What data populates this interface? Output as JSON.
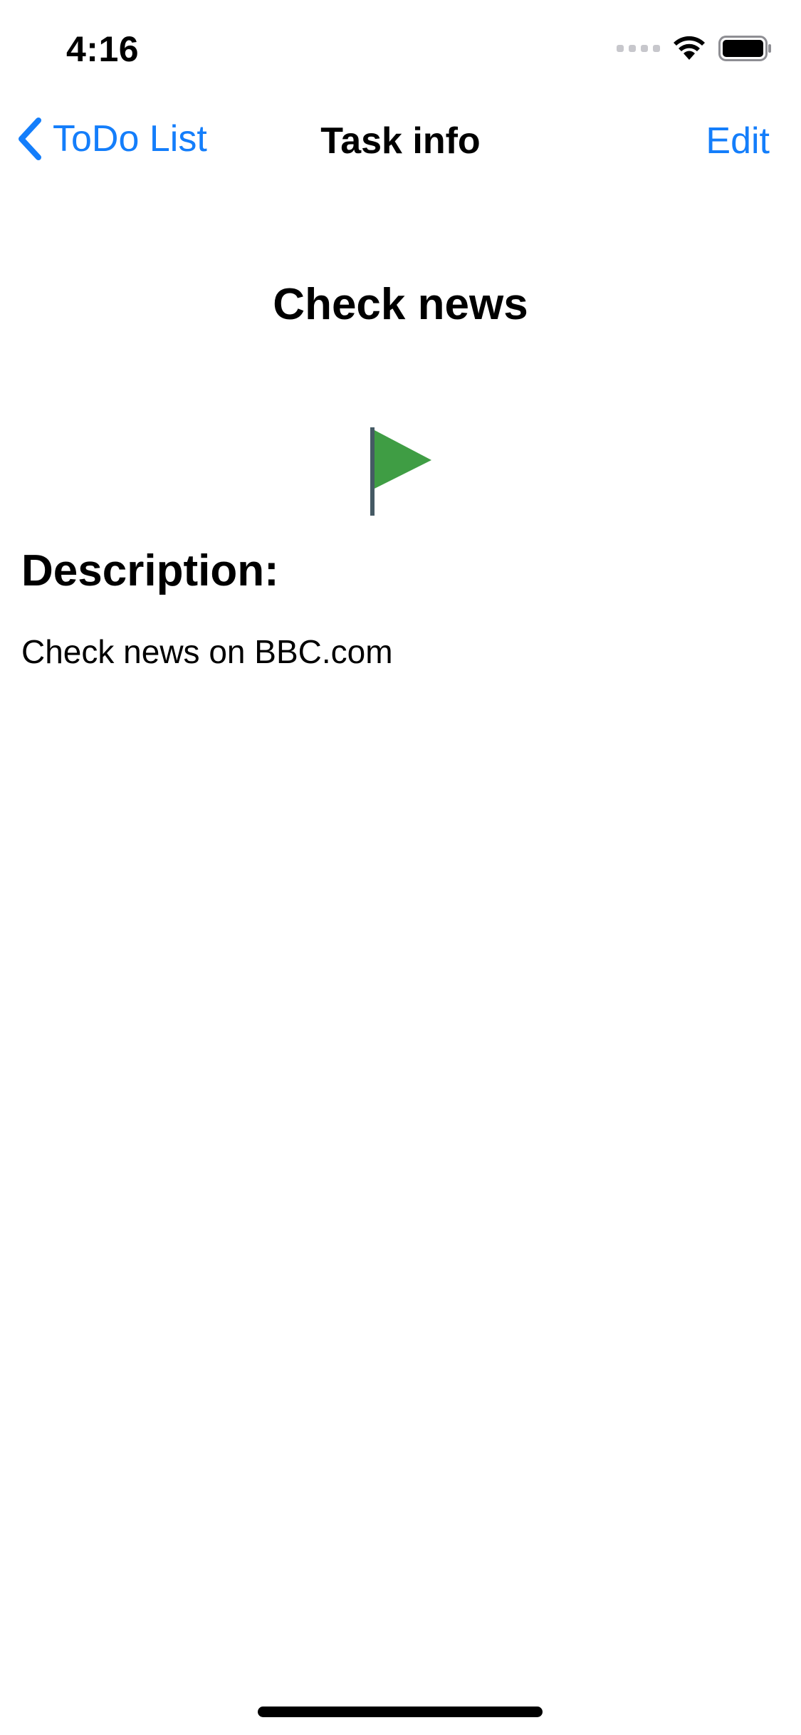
{
  "status_bar": {
    "time": "4:16",
    "icons": [
      "cellular-signal-icon",
      "wifi-icon",
      "battery-icon"
    ]
  },
  "nav": {
    "back_label": "ToDo List",
    "title": "Task info",
    "edit_label": "Edit"
  },
  "task": {
    "title": "Check news",
    "flag_icon": "green-flag-icon",
    "flag_color": "#3f9d44",
    "description_heading": "Description:",
    "description": "Check news on BBC.com"
  },
  "colors": {
    "accent": "#147efb",
    "text": "#000000",
    "background": "#ffffff"
  }
}
